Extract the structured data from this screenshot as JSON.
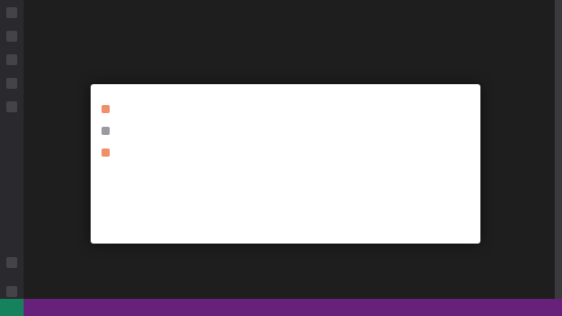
{
  "editor": {
    "title": "",
    "caption": ""
  },
  "panel": {
    "header": "",
    "note": "",
    "tips": [
      {
        "title": "",
        "line1": "",
        "line2": "",
        "bullet": "orange"
      },
      {
        "title": "",
        "line1": "",
        "line2": "",
        "bullet": "gray"
      },
      {
        "title": "",
        "line1": "",
        "line2": "",
        "bullet": "orange"
      }
    ]
  },
  "status_bar": {
    "left_text": "",
    "right_text": ""
  },
  "colors": {
    "status_bar": "#68217a",
    "remote_indicator": "#16825d",
    "accent_bullet": "#f0906a"
  }
}
